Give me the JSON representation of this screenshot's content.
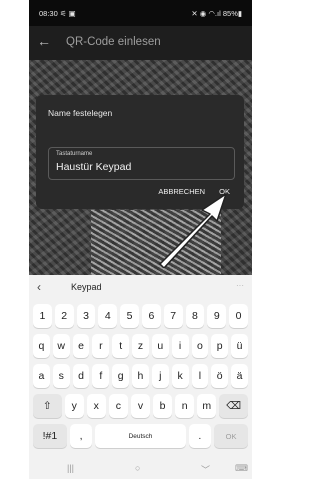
{
  "status": {
    "time": "08:30",
    "time_icons": "⚟ ▣",
    "right": "✕ ◉ ◠.ıl 85%▮"
  },
  "appbar": {
    "back_glyph": "←",
    "title": "QR-Code einlesen"
  },
  "dialog": {
    "title": "Name festelegen",
    "field_label": "Tastaturname",
    "field_value": "Haustür Keypad",
    "cancel": "ABBRECHEN",
    "ok": "OK"
  },
  "keyboard": {
    "suggest_back": "‹",
    "suggest_word": "Keypad",
    "suggest_more": "···",
    "row_numbers": [
      "1",
      "2",
      "3",
      "4",
      "5",
      "6",
      "7",
      "8",
      "9",
      "0"
    ],
    "row1": [
      "q",
      "w",
      "e",
      "r",
      "t",
      "z",
      "u",
      "i",
      "o",
      "p",
      "ü"
    ],
    "row2": [
      "a",
      "s",
      "d",
      "f",
      "g",
      "h",
      "j",
      "k",
      "l",
      "ö",
      "ä"
    ],
    "row3": [
      "y",
      "x",
      "c",
      "v",
      "b",
      "n",
      "m"
    ],
    "shift": "⇧",
    "backspace": "⌫",
    "sym": "!#1",
    "comma": ",",
    "space": "Deutsch",
    "period": ".",
    "ok": "OK"
  },
  "nav": {
    "recents": "|||",
    "home": "○",
    "back": "﹀",
    "kbd": "⌨"
  },
  "colors": {
    "dialog_bg": "#2a2a2a",
    "keyboard_bg": "#f2f2f2"
  }
}
